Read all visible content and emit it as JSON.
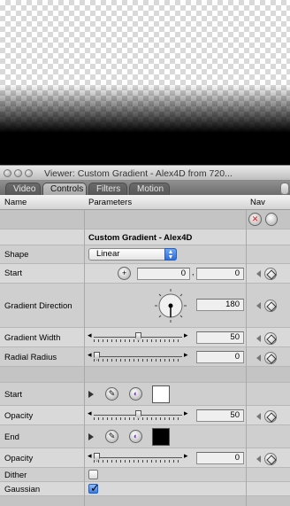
{
  "window": {
    "title": "Viewer: Custom Gradient - Alex4D from 720..."
  },
  "tabs": [
    {
      "label": "Video"
    },
    {
      "label": "Controls"
    },
    {
      "label": "Filters"
    },
    {
      "label": "Motion"
    }
  ],
  "active_tab": "Controls",
  "table": {
    "headers": {
      "name": "Name",
      "parameters": "Parameters",
      "nav": "Nav"
    },
    "effect_name": "Custom Gradient - Alex4D",
    "rows": {
      "shape": {
        "label": "Shape",
        "value": "Linear"
      },
      "start": {
        "label": "Start",
        "x": "0",
        "y": "0"
      },
      "gradient_direction": {
        "label": "Gradient Direction",
        "value": "180"
      },
      "gradient_width": {
        "label": "Gradient Width",
        "value": "50",
        "level": 0.5
      },
      "radial_radius": {
        "label": "Radial Radius",
        "value": "0",
        "level": 0
      },
      "start_color": {
        "label": "Start",
        "swatch": "#ffffff"
      },
      "start_opacity": {
        "label": "Opacity",
        "value": "50",
        "level": 0.5
      },
      "end_color": {
        "label": "End",
        "swatch": "#000000"
      },
      "end_opacity": {
        "label": "Opacity",
        "value": "0",
        "level": 0
      },
      "dither": {
        "label": "Dither",
        "checked": false
      },
      "gaussian": {
        "label": "Gaussian",
        "checked": true
      }
    }
  },
  "colors": {
    "accent_blue": "#2f6fd6",
    "remove_button": "#c02020"
  }
}
